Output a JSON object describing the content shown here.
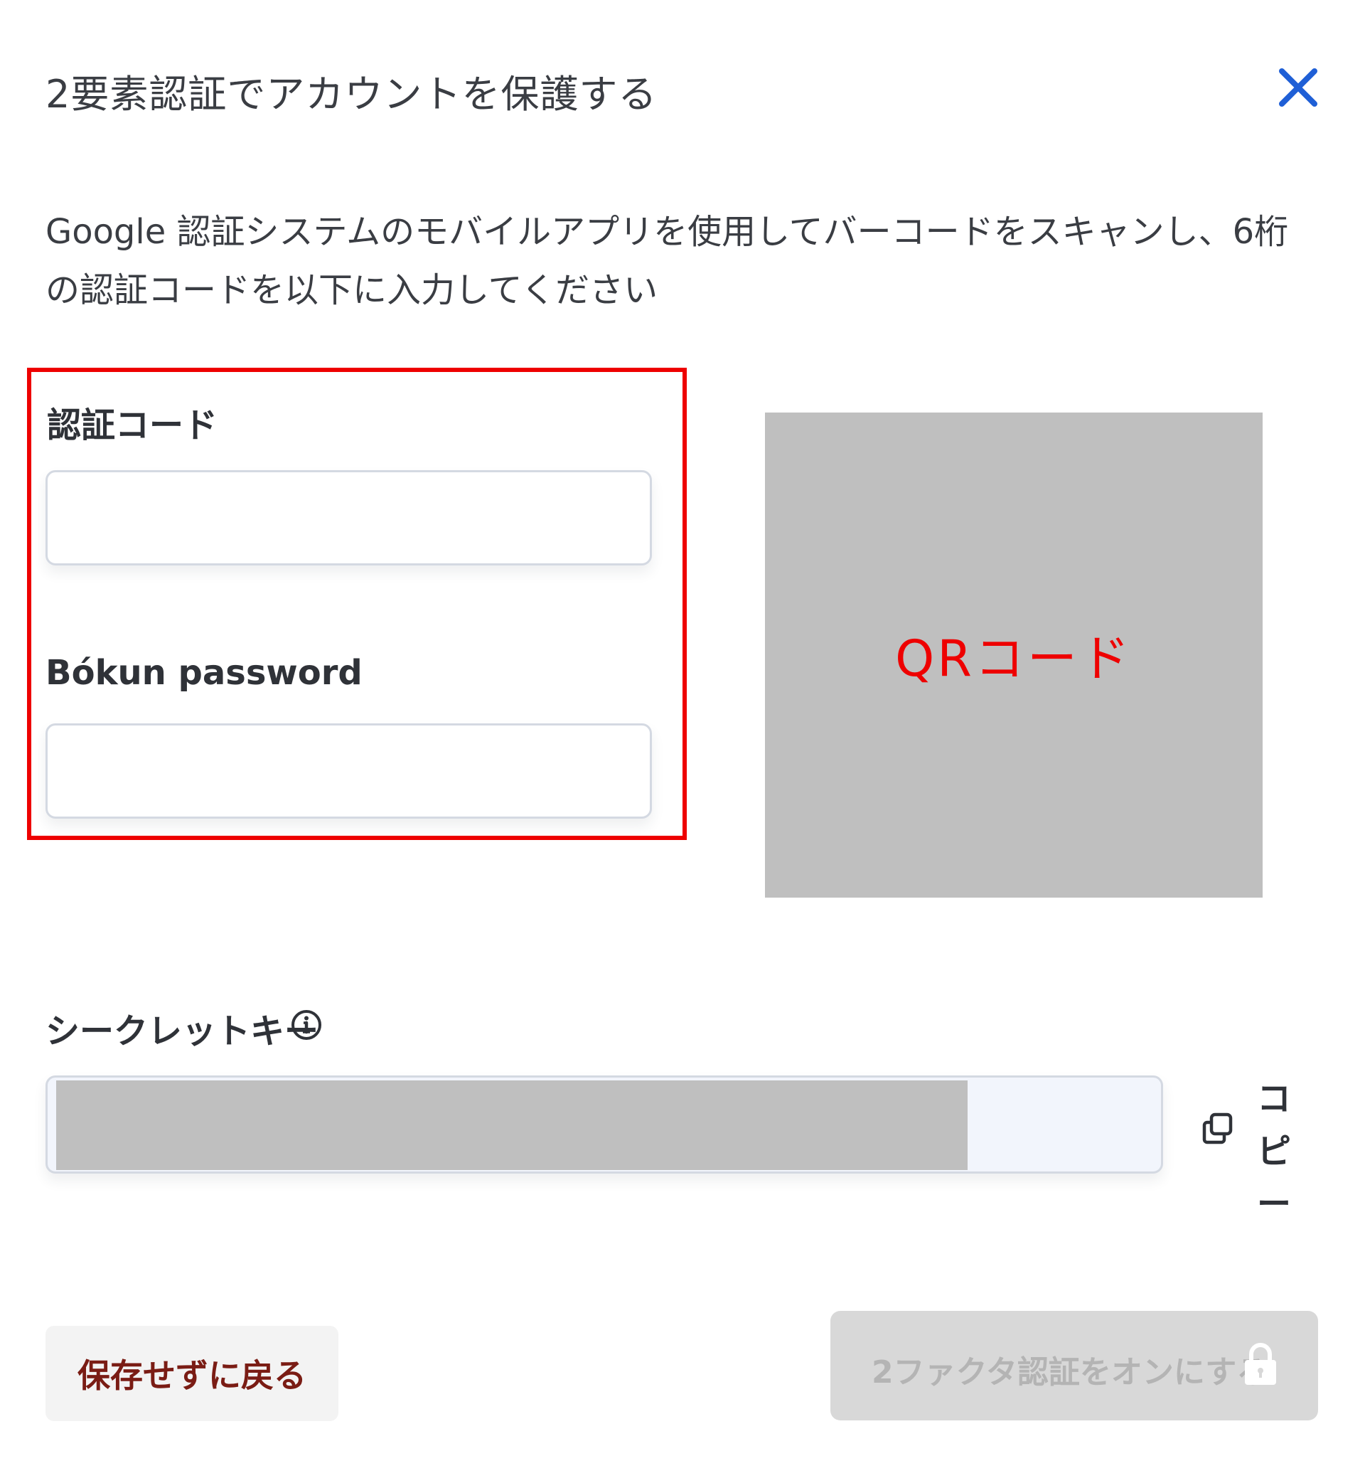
{
  "dialog": {
    "title": "2要素認証でアカウントを保護する",
    "close_icon": "close-icon",
    "description": "Google 認証システムのモバイルアプリを使用してバーコードをスキャンし、6桁の認証コードを以下に入力してください"
  },
  "form": {
    "code_label": "認証コード",
    "code_value": "",
    "password_label": "Bókun password",
    "password_value": ""
  },
  "qr": {
    "placeholder_text": "QRコード"
  },
  "secret": {
    "label": "シークレットキー",
    "info_icon": "info-icon",
    "copy_label": "コピー",
    "copy_icon": "copy-icon"
  },
  "actions": {
    "back_label": "保存せずに戻る",
    "enable_label": "2ファクタ認証をオンにする",
    "enable_icon": "lock-icon"
  },
  "colors": {
    "accent": "#1f5fd6",
    "highlight": "#ee0000",
    "back_text": "#7a1c14",
    "disabled_bg": "#d8d8d8"
  }
}
